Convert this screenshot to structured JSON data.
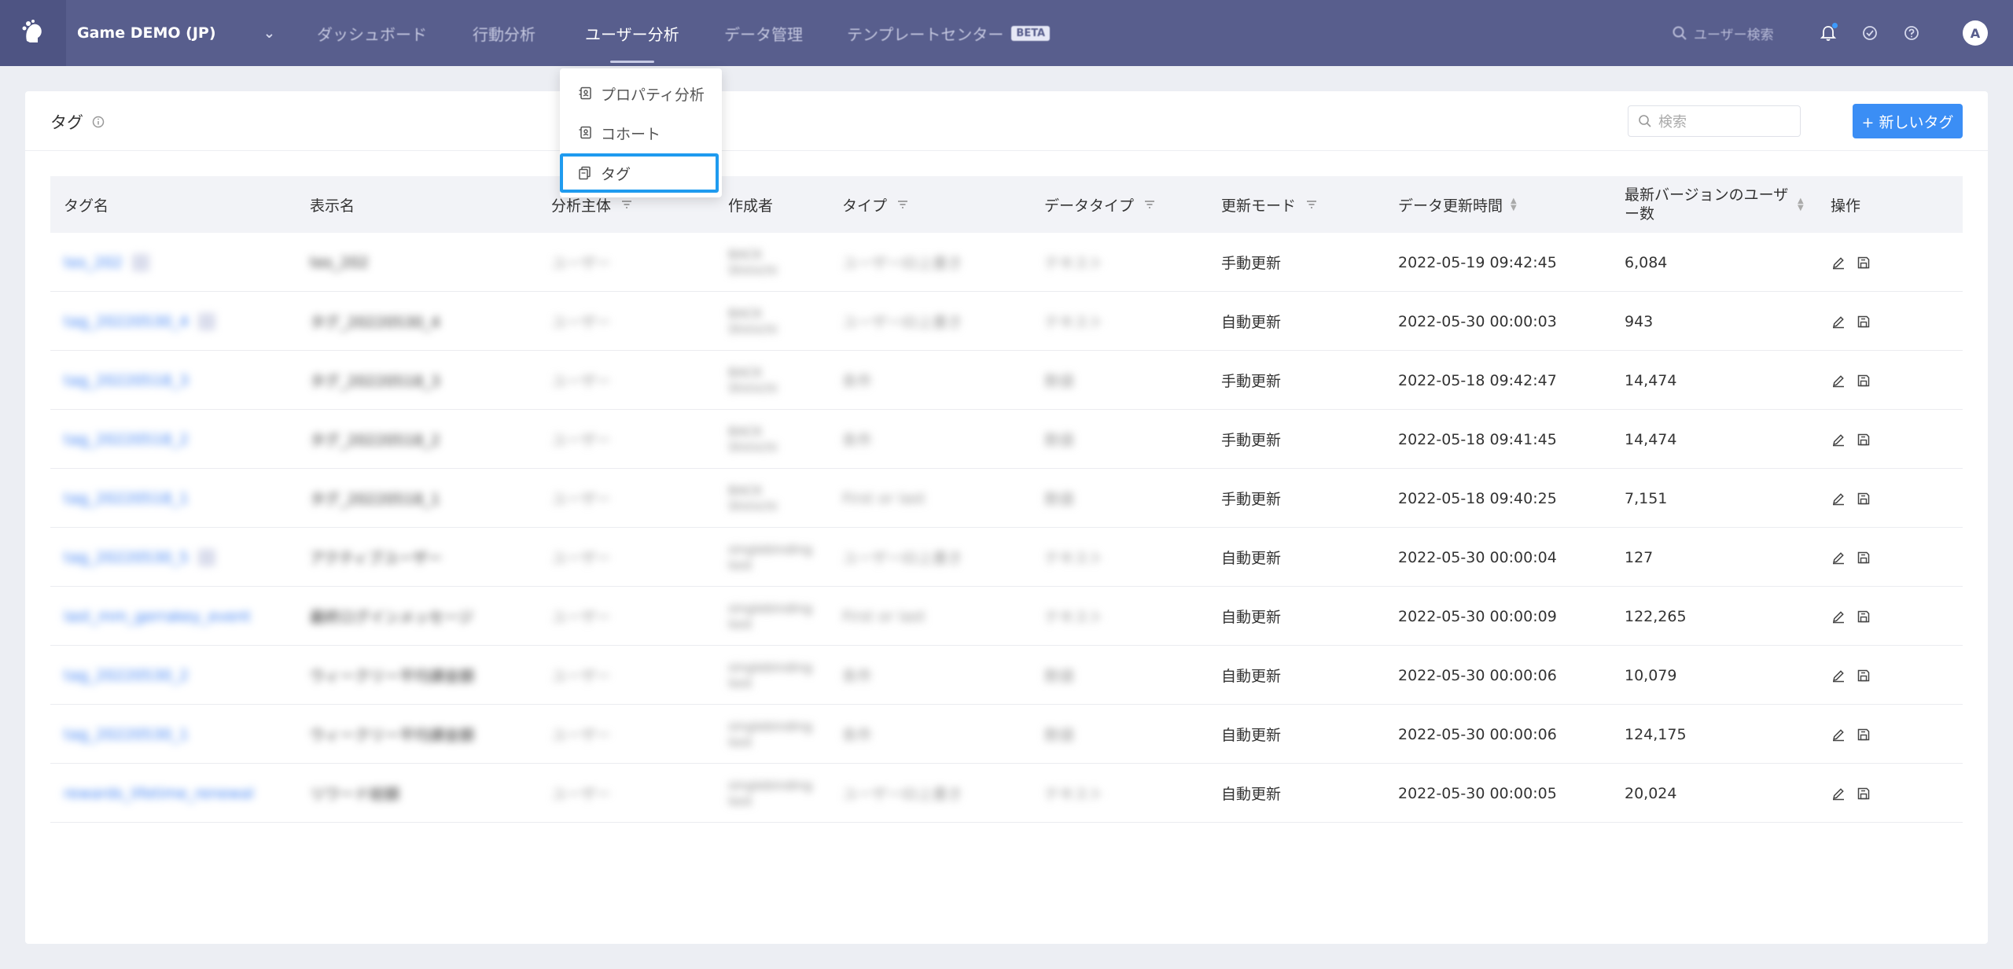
{
  "nav": {
    "project": "Game DEMO (JP)",
    "items": [
      "ダッシュボード",
      "行動分析",
      "ユーザー分析",
      "データ管理",
      "テンプレートセンター"
    ],
    "beta": "BETA",
    "search_placeholder": "ユーザー検索",
    "avatar": "A",
    "active_index": 2
  },
  "dropdown": {
    "items": [
      "プロパティ分析",
      "コホート",
      "タグ"
    ],
    "selected_index": 2
  },
  "page": {
    "title": "タグ",
    "search_placeholder": "検索",
    "new_button": "+ 新しいタグ"
  },
  "table": {
    "headers": [
      "タグ名",
      "表示名",
      "分析主体",
      "作成者",
      "タイプ",
      "データタイプ",
      "更新モード",
      "データ更新時間",
      "最新バージョンのユーザー数",
      "操作"
    ],
    "rows": [
      {
        "name": "tes_202",
        "display": "tes_202",
        "subject": "ユーザー",
        "creator": "BACK Shinichi",
        "type": "ユーザーID上書き",
        "dtype": "テキスト",
        "mode": "手動更新",
        "time": "2022-05-19 09:42:45",
        "users": "6,084"
      },
      {
        "name": "tag_20220530_4",
        "display": "タグ_20220530_4",
        "subject": "ユーザー",
        "creator": "BACK Shinichi",
        "type": "ユーザーID上書き",
        "dtype": "テキスト",
        "mode": "自動更新",
        "time": "2022-05-30 00:00:03",
        "users": "943"
      },
      {
        "name": "tag_20220518_3",
        "display": "タグ_20220518_3",
        "subject": "ユーザー",
        "creator": "BACK Shinichi",
        "type": "条件",
        "dtype": "数値",
        "mode": "手動更新",
        "time": "2022-05-18 09:42:47",
        "users": "14,474"
      },
      {
        "name": "tag_20220518_2",
        "display": "タグ_20220518_2",
        "subject": "ユーザー",
        "creator": "BACK Shinichi",
        "type": "条件",
        "dtype": "数値",
        "mode": "手動更新",
        "time": "2022-05-18 09:41:45",
        "users": "14,474"
      },
      {
        "name": "tag_20220518_1",
        "display": "タグ_20220518_1",
        "subject": "ユーザー",
        "creator": "BACK Shinichi",
        "type": "First or last",
        "dtype": "数値",
        "mode": "手動更新",
        "time": "2022-05-18 09:40:25",
        "users": "7,151"
      },
      {
        "name": "tag_20220530_5",
        "display": "アクティブユーザー",
        "subject": "ユーザー",
        "creator": "singlebinding test",
        "type": "ユーザーID上書き",
        "dtype": "テキスト",
        "mode": "自動更新",
        "time": "2022-05-30 00:00:04",
        "users": "127"
      },
      {
        "name": "last_mm_gerrakey_event",
        "display": "最終ログインメッセージ",
        "subject": "ユーザー",
        "creator": "singlebinding test",
        "type": "First or last",
        "dtype": "テキスト",
        "mode": "自動更新",
        "time": "2022-05-30 00:00:09",
        "users": "122,265"
      },
      {
        "name": "tag_20220530_2",
        "display": "ウィークリー平均課金額",
        "subject": "ユーザー",
        "creator": "singlebinding test",
        "type": "条件",
        "dtype": "数値",
        "mode": "自動更新",
        "time": "2022-05-30 00:00:06",
        "users": "10,079"
      },
      {
        "name": "tag_20220530_1",
        "display": "ウィークリー平均課金額",
        "subject": "ユーザー",
        "creator": "singlebinding test",
        "type": "条件",
        "dtype": "数値",
        "mode": "自動更新",
        "time": "2022-05-30 00:00:06",
        "users": "124,175"
      },
      {
        "name": "rewards_lifetime_renewal",
        "display": "リワード総額",
        "subject": "ユーザー",
        "creator": "singlebinding test",
        "type": "ユーザーID上書き",
        "dtype": "テキスト",
        "mode": "自動更新",
        "time": "2022-05-30 00:00:05",
        "users": "20,024"
      }
    ]
  },
  "colors": {
    "nav_bg": "#585e8d",
    "accent": "#3b8ef5",
    "highlight": "#1f9bef"
  }
}
